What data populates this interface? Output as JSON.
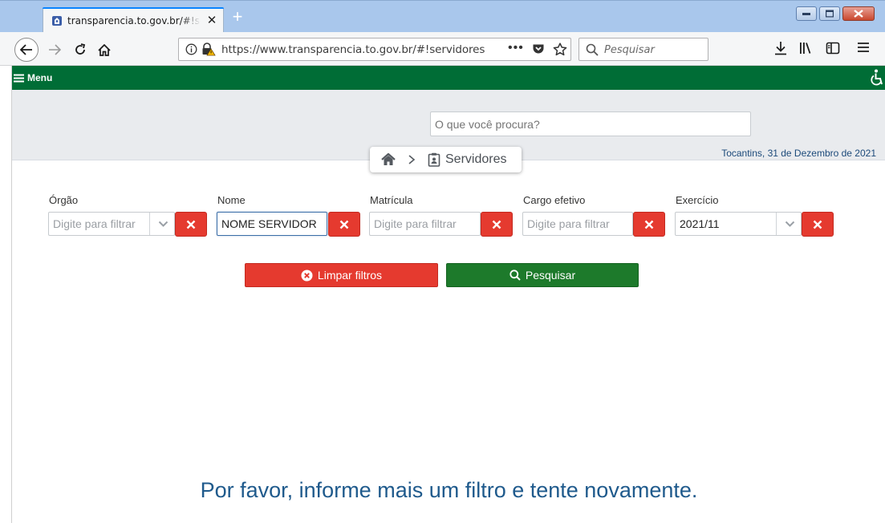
{
  "browser": {
    "tab_title": "transparencia.to.gov.br/#!servidores",
    "url": "https://www.transparencia.to.gov.br/#!servidores",
    "search_placeholder": "Pesquisar",
    "page_actions_label": "•••"
  },
  "site": {
    "menu_label": "Menu",
    "search_placeholder": "O que você procura?",
    "date_line": "Tocantins, 31 de Dezembro de 2021",
    "breadcrumb": {
      "current": "Servidores"
    }
  },
  "filters": {
    "orgao": {
      "label": "Órgão",
      "placeholder": "Digite para filtrar"
    },
    "nome": {
      "label": "Nome",
      "value": "NOME SERVIDOR"
    },
    "matricula": {
      "label": "Matrícula",
      "placeholder": "Digite para filtrar"
    },
    "cargo": {
      "label": "Cargo efetivo",
      "placeholder": "Digite para filtrar"
    },
    "exercicio": {
      "label": "Exercício",
      "value": "2021/11"
    }
  },
  "actions": {
    "clear_label": "Limpar filtros",
    "search_label": "Pesquisar"
  },
  "message": "Por favor, informe mais um filtro e tente novamente.",
  "colors": {
    "brand_green": "#006d36",
    "danger_red": "#e53a2f",
    "action_green": "#1d7a2b",
    "message_blue": "#1f5a8c"
  }
}
